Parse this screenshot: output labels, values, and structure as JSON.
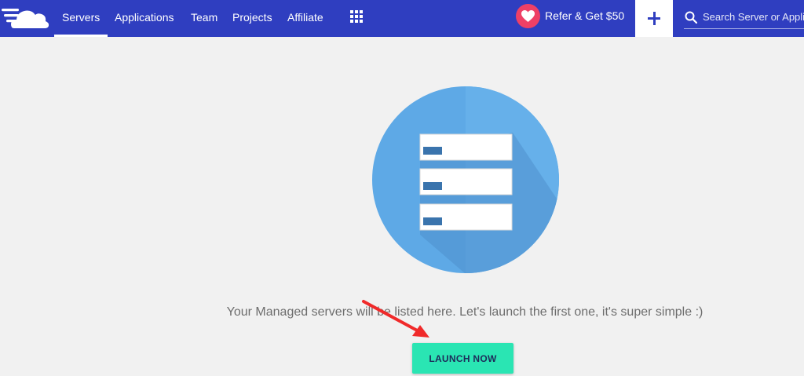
{
  "nav": {
    "items": [
      {
        "label": "Servers",
        "active": true
      },
      {
        "label": "Applications",
        "active": false
      },
      {
        "label": "Team",
        "active": false
      },
      {
        "label": "Projects",
        "active": false
      },
      {
        "label": "Affiliate",
        "active": false
      }
    ],
    "apps_icon": "grid-icon",
    "refer_label": "Refer & Get $50",
    "refer_icon": "heart-icon",
    "add_icon": "plus-icon",
    "search": {
      "placeholder": "Search Server or Application",
      "value": "",
      "icon": "search-icon"
    }
  },
  "empty_state": {
    "illustration_icon": "servers-icon",
    "message": "Your Managed servers will be listed here. Let's launch the first one, it's super simple :)",
    "cta_label": "LAUNCH NOW",
    "annotation_icon": "red-arrow-icon"
  },
  "colors": {
    "topbar": "#2f3ec0",
    "background": "#f1f1f1",
    "accent_cta": "#2ae5b3",
    "heart": "#ee4066",
    "illustration_circle": "#5ea9e6",
    "arrow": "#f02a2a"
  }
}
